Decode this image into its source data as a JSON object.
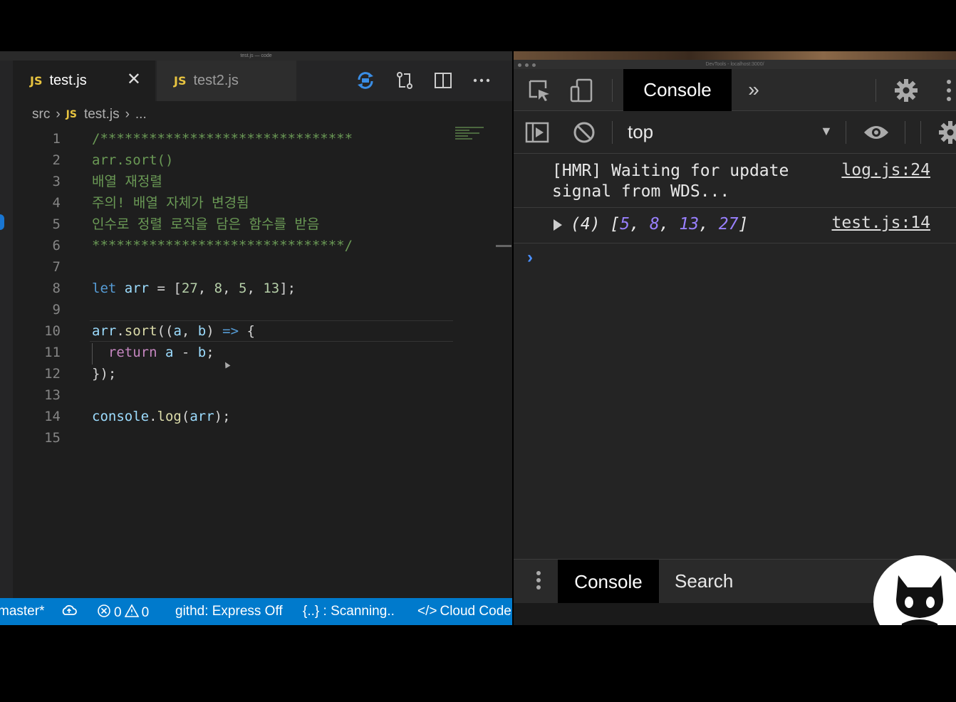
{
  "vscode": {
    "window_title": "test.js — code",
    "tabs": [
      {
        "badge": "JS",
        "label": "test.js",
        "close": "✕",
        "active": true
      },
      {
        "badge": "JS",
        "label": "test2.js",
        "active": false
      }
    ],
    "breadcrumb": {
      "folder": "src",
      "badge": "JS",
      "file": "test.js",
      "more": "..."
    },
    "line_numbers": [
      "1",
      "2",
      "3",
      "4",
      "5",
      "6",
      "7",
      "8",
      "9",
      "10",
      "11",
      "12",
      "13",
      "14",
      "15"
    ],
    "code": {
      "l1": "/*******************************",
      "l2": "arr.sort()",
      "l3": "배열 재정렬",
      "l4": "주의! 배열 자체가 변경됨",
      "l5": "인수로 정렬 로직을 담은 함수를 받음",
      "l6": "*******************************/",
      "l8_kw": "let",
      "l8_var": "arr",
      "l8_rest": " = [",
      "l8_nums": [
        "27",
        "8",
        "5",
        "13"
      ],
      "l8_end": "];",
      "l10_obj": "arr",
      "l10_fn": "sort",
      "l10_a": "a",
      "l10_b": "b",
      "l10_arrow": "=>",
      "l11_kw": "return",
      "l11_a": "a",
      "l11_b": "b",
      "l12": "});",
      "l14_obj": "console",
      "l14_fn": "log",
      "l14_arg": "arr"
    },
    "status": {
      "branch": "master*",
      "errors": "0",
      "warnings": "0",
      "githd": "githd: Express Off",
      "scanning": "{..} : Scanning..",
      "cloud": "Cloud Code"
    },
    "colors": {
      "statusbar": "#007acc",
      "editor_bg": "#1e1e1e"
    }
  },
  "devtools": {
    "window_title": "DevTools - localhost:3000/",
    "main_tab": "Console",
    "more_tabs_icon": "»",
    "context": "top",
    "messages": [
      {
        "text": "[HMR] Waiting for update\nsignal from WDS...",
        "source": "log.js:24"
      },
      {
        "count": "(4)",
        "values": [
          "5",
          "8",
          "13",
          "27"
        ],
        "source": "test.js:14"
      }
    ],
    "prompt": "›",
    "drawer_tabs": [
      "Console",
      "Search"
    ]
  }
}
